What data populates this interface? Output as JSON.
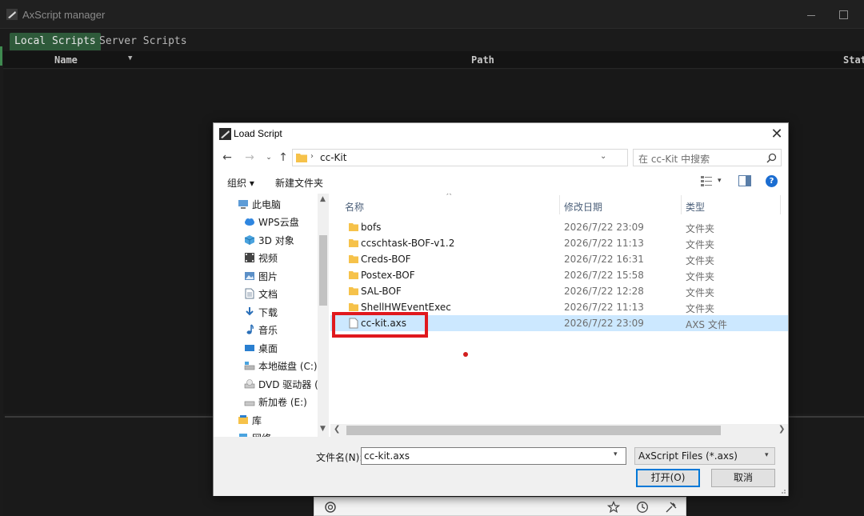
{
  "main_window": {
    "title": "AxScript manager",
    "tabs": [
      "Local Scripts",
      "Server Scripts"
    ],
    "columns": [
      "Name",
      "Path",
      "Stat"
    ]
  },
  "dialog": {
    "title": "Load Script",
    "address": {
      "path": "cc-Kit",
      "search_placeholder": "在 cc-Kit 中搜索"
    },
    "toolbar": {
      "organize": "组织 ▾",
      "new_folder": "新建文件夹"
    },
    "nav_items": [
      {
        "label": "此电脑",
        "icon": "pc-icon"
      },
      {
        "label": "WPS云盘",
        "icon": "cloud-icon"
      },
      {
        "label": "3D 对象",
        "icon": "cube-icon"
      },
      {
        "label": "视频",
        "icon": "video-icon"
      },
      {
        "label": "图片",
        "icon": "picture-icon"
      },
      {
        "label": "文档",
        "icon": "document-icon"
      },
      {
        "label": "下载",
        "icon": "download-icon"
      },
      {
        "label": "音乐",
        "icon": "music-icon"
      },
      {
        "label": "桌面",
        "icon": "desktop-icon"
      },
      {
        "label": "本地磁盘 (C:)",
        "icon": "drive-icon"
      },
      {
        "label": "DVD 驱动器 (D",
        "icon": "dvd-icon"
      },
      {
        "label": "新加卷 (E:)",
        "icon": "drive-icon"
      },
      {
        "label": "库",
        "icon": "library-icon"
      },
      {
        "label": "网络",
        "icon": "network-icon"
      }
    ],
    "list_headers": {
      "name": "名称",
      "date": "修改日期",
      "type": "类型"
    },
    "files": [
      {
        "name": "bofs",
        "date": "2026/7/22 23:09",
        "type": "文件夹",
        "kind": "folder"
      },
      {
        "name": "ccschtask-BOF-v1.2",
        "date": "2026/7/22 11:13",
        "type": "文件夹",
        "kind": "folder"
      },
      {
        "name": "Creds-BOF",
        "date": "2026/7/22 16:31",
        "type": "文件夹",
        "kind": "folder"
      },
      {
        "name": "Postex-BOF",
        "date": "2026/7/22 15:58",
        "type": "文件夹",
        "kind": "folder"
      },
      {
        "name": "SAL-BOF",
        "date": "2026/7/22 12:28",
        "type": "文件夹",
        "kind": "folder"
      },
      {
        "name": "ShellHWEventExec",
        "date": "2026/7/22 11:13",
        "type": "文件夹",
        "kind": "folder"
      },
      {
        "name": "cc-kit.axs",
        "date": "2026/7/22 23:09",
        "type": "AXS 文件",
        "kind": "file",
        "selected": true
      }
    ],
    "footer": {
      "filename_label": "文件名(N):",
      "filename_value": "cc-kit.axs",
      "filetype": "AxScript Files (*.axs)",
      "open_label": "打开(O)",
      "cancel_label": "取消"
    }
  },
  "colors": {
    "tab_active": "#2e5a3a",
    "selection": "#cce8ff",
    "highlight": "#e0191e",
    "help_blue": "#1b6dd1"
  }
}
